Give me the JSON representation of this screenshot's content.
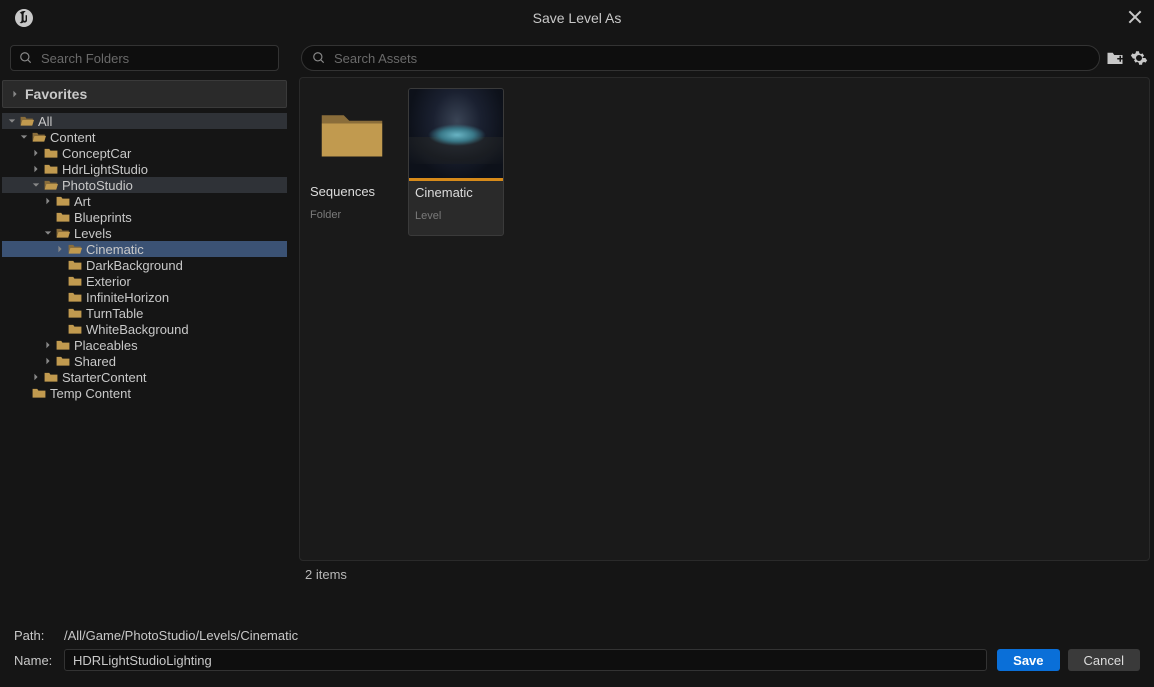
{
  "window": {
    "title": "Save Level As"
  },
  "sidebar": {
    "search_placeholder": "Search Folders",
    "favorites_label": "Favorites",
    "tree": [
      {
        "d": 0,
        "e": true,
        "a": true,
        "ic": "open",
        "label": "All",
        "hl": "dark"
      },
      {
        "d": 1,
        "e": true,
        "a": true,
        "ic": "open",
        "label": "Content"
      },
      {
        "d": 2,
        "e": false,
        "a": true,
        "ic": "closed",
        "label": "ConceptCar"
      },
      {
        "d": 2,
        "e": false,
        "a": true,
        "ic": "closed",
        "label": "HdrLightStudio"
      },
      {
        "d": 2,
        "e": true,
        "a": true,
        "ic": "open",
        "label": "PhotoStudio",
        "hl": "dark"
      },
      {
        "d": 3,
        "e": false,
        "a": true,
        "ic": "closed",
        "label": "Art"
      },
      {
        "d": 3,
        "e": false,
        "a": false,
        "ic": "closed",
        "label": "Blueprints"
      },
      {
        "d": 3,
        "e": true,
        "a": true,
        "ic": "open",
        "label": "Levels"
      },
      {
        "d": 4,
        "e": false,
        "a": true,
        "ic": "open",
        "label": "Cinematic",
        "sel": true
      },
      {
        "d": 4,
        "e": false,
        "a": false,
        "ic": "closed",
        "label": "DarkBackground"
      },
      {
        "d": 4,
        "e": false,
        "a": false,
        "ic": "closed",
        "label": "Exterior"
      },
      {
        "d": 4,
        "e": false,
        "a": false,
        "ic": "closed",
        "label": "InfiniteHorizon"
      },
      {
        "d": 4,
        "e": false,
        "a": false,
        "ic": "closed",
        "label": "TurnTable"
      },
      {
        "d": 4,
        "e": false,
        "a": false,
        "ic": "closed",
        "label": "WhiteBackground"
      },
      {
        "d": 3,
        "e": false,
        "a": true,
        "ic": "closed",
        "label": "Placeables"
      },
      {
        "d": 3,
        "e": false,
        "a": true,
        "ic": "closed",
        "label": "Shared"
      },
      {
        "d": 2,
        "e": false,
        "a": true,
        "ic": "closed",
        "label": "StarterContent"
      },
      {
        "d": 1,
        "e": false,
        "a": false,
        "ic": "closed",
        "label": "Temp Content"
      }
    ]
  },
  "content": {
    "search_placeholder": "Search Assets",
    "items": [
      {
        "name": "Sequences",
        "type": "Folder",
        "kind": "folder"
      },
      {
        "name": "Cinematic",
        "type": "Level",
        "kind": "level"
      }
    ],
    "status": "2 items"
  },
  "bottom": {
    "path_label": "Path:",
    "path_value": "/All/Game/PhotoStudio/Levels/Cinematic",
    "name_label": "Name:",
    "name_value": "HDRLightStudioLighting",
    "save_label": "Save",
    "cancel_label": "Cancel"
  }
}
